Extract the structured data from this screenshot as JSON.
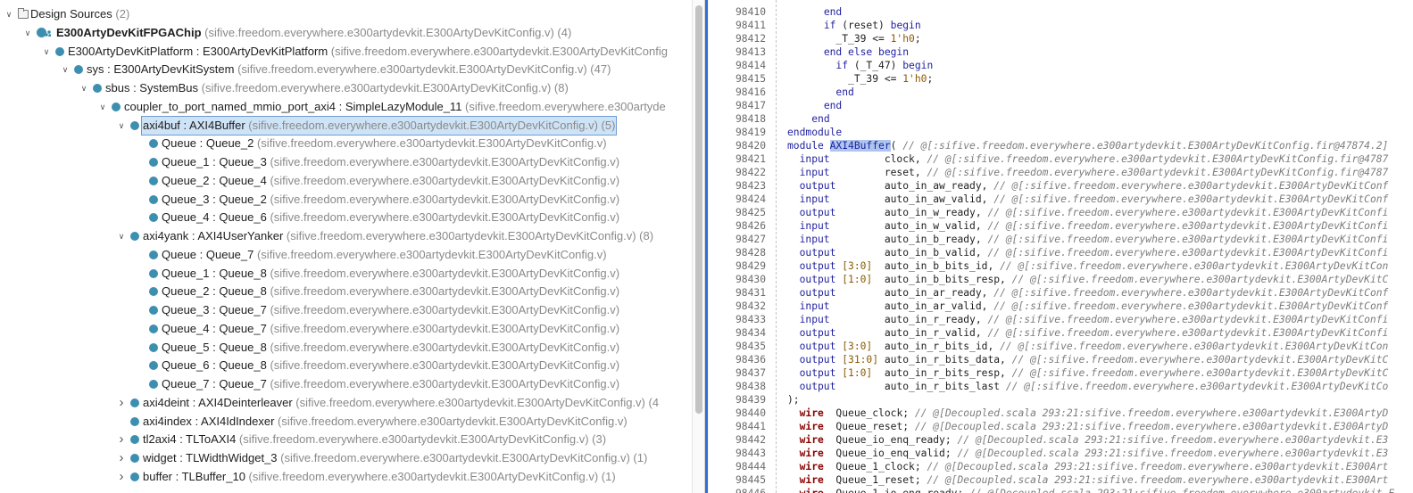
{
  "tree": {
    "rows": [
      {
        "level": 0,
        "toggle": "down",
        "icon": "folder",
        "name": "Design Sources",
        "detail": " (2)"
      },
      {
        "level": 1,
        "toggle": "down",
        "icon": "top",
        "name": "E300ArtyDevKitFPGAChip",
        "bold": true,
        "detail": " (sifive.freedom.everywhere.e300artydevkit.E300ArtyDevKitConfig.v) (4)"
      },
      {
        "level": 2,
        "toggle": "down",
        "icon": "node",
        "name": "E300ArtyDevKitPlatform : E300ArtyDevKitPlatform",
        "detail": " (sifive.freedom.everywhere.e300artydevkit.E300ArtyDevKitConfig"
      },
      {
        "level": 3,
        "toggle": "down",
        "icon": "node",
        "name": "sys : E300ArtyDevKitSystem",
        "detail": " (sifive.freedom.everywhere.e300artydevkit.E300ArtyDevKitConfig.v) (47)"
      },
      {
        "level": 4,
        "toggle": "down",
        "icon": "node",
        "name": "sbus : SystemBus",
        "detail": " (sifive.freedom.everywhere.e300artydevkit.E300ArtyDevKitConfig.v) (8)"
      },
      {
        "level": 5,
        "toggle": "down",
        "icon": "node",
        "name": "coupler_to_port_named_mmio_port_axi4 : SimpleLazyModule_11",
        "detail": " (sifive.freedom.everywhere.e300artyde"
      },
      {
        "level": 6,
        "toggle": "down",
        "icon": "node",
        "name": "axi4buf : AXI4Buffer",
        "detail": " (sifive.freedom.everywhere.e300artydevkit.E300ArtyDevKitConfig.v) (5)",
        "selected": true
      },
      {
        "level": 7,
        "toggle": "",
        "icon": "node",
        "name": "Queue : Queue_2",
        "detail": " (sifive.freedom.everywhere.e300artydevkit.E300ArtyDevKitConfig.v)"
      },
      {
        "level": 7,
        "toggle": "",
        "icon": "node",
        "name": "Queue_1 : Queue_3",
        "detail": " (sifive.freedom.everywhere.e300artydevkit.E300ArtyDevKitConfig.v)"
      },
      {
        "level": 7,
        "toggle": "",
        "icon": "node",
        "name": "Queue_2 : Queue_4",
        "detail": " (sifive.freedom.everywhere.e300artydevkit.E300ArtyDevKitConfig.v)"
      },
      {
        "level": 7,
        "toggle": "",
        "icon": "node",
        "name": "Queue_3 : Queue_2",
        "detail": " (sifive.freedom.everywhere.e300artydevkit.E300ArtyDevKitConfig.v)"
      },
      {
        "level": 7,
        "toggle": "",
        "icon": "node",
        "name": "Queue_4 : Queue_6",
        "detail": " (sifive.freedom.everywhere.e300artydevkit.E300ArtyDevKitConfig.v)"
      },
      {
        "level": 6,
        "toggle": "down",
        "icon": "node",
        "name": "axi4yank : AXI4UserYanker",
        "detail": " (sifive.freedom.everywhere.e300artydevkit.E300ArtyDevKitConfig.v) (8)"
      },
      {
        "level": 7,
        "toggle": "",
        "icon": "node",
        "name": "Queue : Queue_7",
        "detail": " (sifive.freedom.everywhere.e300artydevkit.E300ArtyDevKitConfig.v)"
      },
      {
        "level": 7,
        "toggle": "",
        "icon": "node",
        "name": "Queue_1 : Queue_8",
        "detail": " (sifive.freedom.everywhere.e300artydevkit.E300ArtyDevKitConfig.v)"
      },
      {
        "level": 7,
        "toggle": "",
        "icon": "node",
        "name": "Queue_2 : Queue_8",
        "detail": " (sifive.freedom.everywhere.e300artydevkit.E300ArtyDevKitConfig.v)"
      },
      {
        "level": 7,
        "toggle": "",
        "icon": "node",
        "name": "Queue_3 : Queue_7",
        "detail": " (sifive.freedom.everywhere.e300artydevkit.E300ArtyDevKitConfig.v)"
      },
      {
        "level": 7,
        "toggle": "",
        "icon": "node",
        "name": "Queue_4 : Queue_7",
        "detail": " (sifive.freedom.everywhere.e300artydevkit.E300ArtyDevKitConfig.v)"
      },
      {
        "level": 7,
        "toggle": "",
        "icon": "node",
        "name": "Queue_5 : Queue_8",
        "detail": " (sifive.freedom.everywhere.e300artydevkit.E300ArtyDevKitConfig.v)"
      },
      {
        "level": 7,
        "toggle": "",
        "icon": "node",
        "name": "Queue_6 : Queue_8",
        "detail": " (sifive.freedom.everywhere.e300artydevkit.E300ArtyDevKitConfig.v)"
      },
      {
        "level": 7,
        "toggle": "",
        "icon": "node",
        "name": "Queue_7 : Queue_7",
        "detail": " (sifive.freedom.everywhere.e300artydevkit.E300ArtyDevKitConfig.v)"
      },
      {
        "level": 6,
        "toggle": "right",
        "icon": "node",
        "name": "axi4deint : AXI4Deinterleaver",
        "detail": " (sifive.freedom.everywhere.e300artydevkit.E300ArtyDevKitConfig.v) (4"
      },
      {
        "level": 6,
        "toggle": "",
        "icon": "node",
        "name": "axi4index : AXI4IdIndexer",
        "detail": " (sifive.freedom.everywhere.e300artydevkit.E300ArtyDevKitConfig.v)"
      },
      {
        "level": 6,
        "toggle": "right",
        "icon": "node",
        "name": "tl2axi4 : TLToAXI4",
        "detail": " (sifive.freedom.everywhere.e300artydevkit.E300ArtyDevKitConfig.v) (3)"
      },
      {
        "level": 6,
        "toggle": "right",
        "icon": "node",
        "name": "widget : TLWidthWidget_3",
        "detail": " (sifive.freedom.everywhere.e300artydevkit.E300ArtyDevKitConfig.v) (1)"
      },
      {
        "level": 6,
        "toggle": "right",
        "icon": "node",
        "name": "buffer : TLBuffer_10",
        "detail": " (sifive.freedom.everywhere.e300artydevkit.E300ArtyDevKitConfig.v) (1)"
      }
    ]
  },
  "editor": {
    "lines": [
      {
        "n": "98410",
        "t": [
          [
            "plain",
            "      "
          ],
          [
            "kw",
            "end"
          ]
        ]
      },
      {
        "n": "98411",
        "t": [
          [
            "plain",
            "      "
          ],
          [
            "kw",
            "if"
          ],
          [
            "plain",
            " (reset) "
          ],
          [
            "kw",
            "begin"
          ]
        ]
      },
      {
        "n": "98412",
        "t": [
          [
            "plain",
            "        _T_39 <= "
          ],
          [
            "num",
            "1'h0"
          ],
          [
            "plain",
            ";"
          ]
        ]
      },
      {
        "n": "98413",
        "t": [
          [
            "plain",
            "      "
          ],
          [
            "kw",
            "end else begin"
          ]
        ]
      },
      {
        "n": "98414",
        "t": [
          [
            "plain",
            "        "
          ],
          [
            "kw",
            "if"
          ],
          [
            "plain",
            " (_T_47) "
          ],
          [
            "kw",
            "begin"
          ]
        ]
      },
      {
        "n": "98415",
        "t": [
          [
            "plain",
            "          _T_39 <= "
          ],
          [
            "num",
            "1'h0"
          ],
          [
            "plain",
            ";"
          ]
        ]
      },
      {
        "n": "98416",
        "t": [
          [
            "plain",
            "        "
          ],
          [
            "kw",
            "end"
          ]
        ]
      },
      {
        "n": "98417",
        "t": [
          [
            "plain",
            "      "
          ],
          [
            "kw",
            "end"
          ]
        ]
      },
      {
        "n": "98418",
        "t": [
          [
            "plain",
            "    "
          ],
          [
            "kw",
            "end"
          ]
        ]
      },
      {
        "n": "98419",
        "t": [
          [
            "kw",
            "endmodule"
          ]
        ]
      },
      {
        "n": "98420",
        "t": [
          [
            "kw",
            "module "
          ],
          [
            "hl",
            "AXI4Buffer"
          ],
          [
            "plain",
            "( "
          ],
          [
            "cm",
            "// @[:sifive.freedom.everywhere.e300artydevkit.E300ArtyDevKitConfig.fir@47874.2]"
          ]
        ]
      },
      {
        "n": "98421",
        "t": [
          [
            "kw",
            "  input         "
          ],
          [
            "plain",
            "clock, "
          ],
          [
            "cm",
            "// @[:sifive.freedom.everywhere.e300artydevkit.E300ArtyDevKitConfig.fir@4787"
          ]
        ]
      },
      {
        "n": "98422",
        "t": [
          [
            "kw",
            "  input         "
          ],
          [
            "plain",
            "reset, "
          ],
          [
            "cm",
            "// @[:sifive.freedom.everywhere.e300artydevkit.E300ArtyDevKitConfig.fir@4787"
          ]
        ]
      },
      {
        "n": "98423",
        "t": [
          [
            "kw",
            "  output        "
          ],
          [
            "plain",
            "auto_in_aw_ready, "
          ],
          [
            "cm",
            "// @[:sifive.freedom.everywhere.e300artydevkit.E300ArtyDevKitConf"
          ]
        ]
      },
      {
        "n": "98424",
        "t": [
          [
            "kw",
            "  input         "
          ],
          [
            "plain",
            "auto_in_aw_valid, "
          ],
          [
            "cm",
            "// @[:sifive.freedom.everywhere.e300artydevkit.E300ArtyDevKitConf"
          ]
        ]
      },
      {
        "n": "98425",
        "t": [
          [
            "kw",
            "  output        "
          ],
          [
            "plain",
            "auto_in_w_ready, "
          ],
          [
            "cm",
            "// @[:sifive.freedom.everywhere.e300artydevkit.E300ArtyDevKitConfi"
          ]
        ]
      },
      {
        "n": "98426",
        "t": [
          [
            "kw",
            "  input         "
          ],
          [
            "plain",
            "auto_in_w_valid, "
          ],
          [
            "cm",
            "// @[:sifive.freedom.everywhere.e300artydevkit.E300ArtyDevKitConfi"
          ]
        ]
      },
      {
        "n": "98427",
        "t": [
          [
            "kw",
            "  input         "
          ],
          [
            "plain",
            "auto_in_b_ready, "
          ],
          [
            "cm",
            "// @[:sifive.freedom.everywhere.e300artydevkit.E300ArtyDevKitConfi"
          ]
        ]
      },
      {
        "n": "98428",
        "t": [
          [
            "kw",
            "  output        "
          ],
          [
            "plain",
            "auto_in_b_valid, "
          ],
          [
            "cm",
            "// @[:sifive.freedom.everywhere.e300artydevkit.E300ArtyDevKitConfi"
          ]
        ]
      },
      {
        "n": "98429",
        "t": [
          [
            "kw",
            "  output "
          ],
          [
            "num",
            "[3:0]"
          ],
          [
            "plain",
            "  auto_in_b_bits_id, "
          ],
          [
            "cm",
            "// @[:sifive.freedom.everywhere.e300artydevkit.E300ArtyDevKitCon"
          ]
        ]
      },
      {
        "n": "98430",
        "t": [
          [
            "kw",
            "  output "
          ],
          [
            "num",
            "[1:0]"
          ],
          [
            "plain",
            "  auto_in_b_bits_resp, "
          ],
          [
            "cm",
            "// @[:sifive.freedom.everywhere.e300artydevkit.E300ArtyDevKitC"
          ]
        ]
      },
      {
        "n": "98431",
        "t": [
          [
            "kw",
            "  output        "
          ],
          [
            "plain",
            "auto_in_ar_ready, "
          ],
          [
            "cm",
            "// @[:sifive.freedom.everywhere.e300artydevkit.E300ArtyDevKitConf"
          ]
        ]
      },
      {
        "n": "98432",
        "t": [
          [
            "kw",
            "  input         "
          ],
          [
            "plain",
            "auto_in_ar_valid, "
          ],
          [
            "cm",
            "// @[:sifive.freedom.everywhere.e300artydevkit.E300ArtyDevKitConf"
          ]
        ]
      },
      {
        "n": "98433",
        "t": [
          [
            "kw",
            "  input         "
          ],
          [
            "plain",
            "auto_in_r_ready, "
          ],
          [
            "cm",
            "// @[:sifive.freedom.everywhere.e300artydevkit.E300ArtyDevKitConfi"
          ]
        ]
      },
      {
        "n": "98434",
        "t": [
          [
            "kw",
            "  output        "
          ],
          [
            "plain",
            "auto_in_r_valid, "
          ],
          [
            "cm",
            "// @[:sifive.freedom.everywhere.e300artydevkit.E300ArtyDevKitConfi"
          ]
        ]
      },
      {
        "n": "98435",
        "t": [
          [
            "kw",
            "  output "
          ],
          [
            "num",
            "[3:0]"
          ],
          [
            "plain",
            "  auto_in_r_bits_id, "
          ],
          [
            "cm",
            "// @[:sifive.freedom.everywhere.e300artydevkit.E300ArtyDevKitCon"
          ]
        ]
      },
      {
        "n": "98436",
        "t": [
          [
            "kw",
            "  output "
          ],
          [
            "num",
            "[31:0]"
          ],
          [
            "plain",
            " auto_in_r_bits_data, "
          ],
          [
            "cm",
            "// @[:sifive.freedom.everywhere.e300artydevkit.E300ArtyDevKitC"
          ]
        ]
      },
      {
        "n": "98437",
        "t": [
          [
            "kw",
            "  output "
          ],
          [
            "num",
            "[1:0]"
          ],
          [
            "plain",
            "  auto_in_r_bits_resp, "
          ],
          [
            "cm",
            "// @[:sifive.freedom.everywhere.e300artydevkit.E300ArtyDevKitC"
          ]
        ]
      },
      {
        "n": "98438",
        "t": [
          [
            "kw",
            "  output        "
          ],
          [
            "plain",
            "auto_in_r_bits_last "
          ],
          [
            "cm",
            "// @[:sifive.freedom.everywhere.e300artydevkit.E300ArtyDevKitCo"
          ]
        ]
      },
      {
        "n": "98439",
        "t": [
          [
            "plain",
            ");"
          ]
        ]
      },
      {
        "n": "98440",
        "t": [
          [
            "plain",
            "  "
          ],
          [
            "wire",
            "wire"
          ],
          [
            "plain",
            "  Queue_clock; "
          ],
          [
            "cm",
            "// @[Decoupled.scala 293:21:sifive.freedom.everywhere.e300artydevkit.E300ArtyD"
          ]
        ]
      },
      {
        "n": "98441",
        "t": [
          [
            "plain",
            "  "
          ],
          [
            "wire",
            "wire"
          ],
          [
            "plain",
            "  Queue_reset; "
          ],
          [
            "cm",
            "// @[Decoupled.scala 293:21:sifive.freedom.everywhere.e300artydevkit.E300ArtyD"
          ]
        ]
      },
      {
        "n": "98442",
        "t": [
          [
            "plain",
            "  "
          ],
          [
            "wire",
            "wire"
          ],
          [
            "plain",
            "  Queue_io_enq_ready; "
          ],
          [
            "cm",
            "// @[Decoupled.scala 293:21:sifive.freedom.everywhere.e300artydevkit.E3"
          ]
        ]
      },
      {
        "n": "98443",
        "t": [
          [
            "plain",
            "  "
          ],
          [
            "wire",
            "wire"
          ],
          [
            "plain",
            "  Queue_io_enq_valid; "
          ],
          [
            "cm",
            "// @[Decoupled.scala 293:21:sifive.freedom.everywhere.e300artydevkit.E3"
          ]
        ]
      },
      {
        "n": "98444",
        "t": [
          [
            "plain",
            "  "
          ],
          [
            "wire",
            "wire"
          ],
          [
            "plain",
            "  Queue_1_clock; "
          ],
          [
            "cm",
            "// @[Decoupled.scala 293:21:sifive.freedom.everywhere.e300artydevkit.E300Art"
          ]
        ]
      },
      {
        "n": "98445",
        "t": [
          [
            "plain",
            "  "
          ],
          [
            "wire",
            "wire"
          ],
          [
            "plain",
            "  Queue_1_reset; "
          ],
          [
            "cm",
            "// @[Decoupled.scala 293:21:sifive.freedom.everywhere.e300artydevkit.E300Art"
          ]
        ]
      },
      {
        "n": "98446",
        "t": [
          [
            "plain",
            "  "
          ],
          [
            "wire",
            "wire"
          ],
          [
            "plain",
            "  Queue_1_io_enq_ready; "
          ],
          [
            "cm",
            "// @[Decoupled.scala 293:21:sifive.freedom.everywhere.e300artydevkit.E"
          ]
        ]
      }
    ]
  }
}
